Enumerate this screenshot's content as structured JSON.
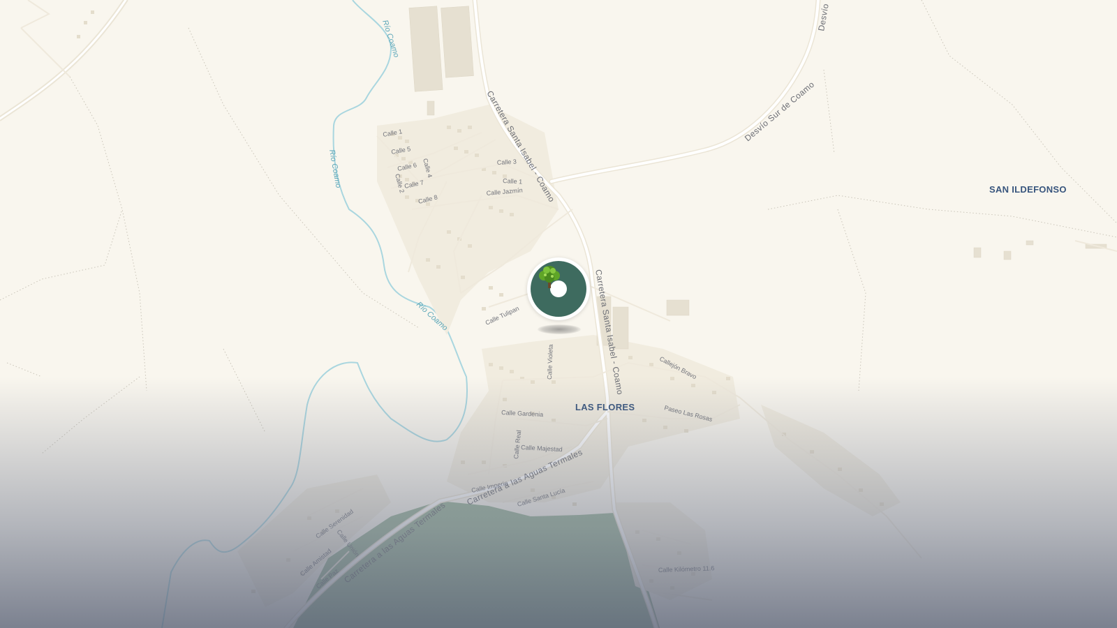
{
  "map": {
    "place_labels": {
      "las_flores": "LAS FLORES",
      "san_ildefonso": "SAN ILDEFONSO"
    },
    "roads": {
      "carretera_si_coamo_north": "Carretera Santa Isabel - Coamo",
      "carretera_si_coamo_south": "Carretera Santa Isabel - Coamo",
      "desvio_sur": "Desvío Sur de Coamo",
      "desvio_top": "Desvío",
      "aguas_termales_1": "Carretera a las Aguas Termales",
      "aguas_termales_2": "Carretera a las Aguas Termales"
    },
    "rivers": {
      "rio_1": "Río Coamo",
      "rio_2": "Río Coamo",
      "rio_3": "Río Coamo"
    },
    "streets": {
      "calle_1_a": "Calle 1",
      "calle_5": "Calle 5",
      "calle_6": "Calle 6",
      "calle_4": "Calle 4",
      "calle_7": "Calle 7",
      "calle_2": "Calle 2",
      "calle_8": "Calle 8",
      "calle_3": "Calle 3",
      "calle_1_b": "Calle 1",
      "calle_jazmin": "Calle Jazmín",
      "calle_tulipan": "Calle Tulipan",
      "calle_violeta": "Calle Violeta",
      "callejon_bravo": "Callejón Bravo",
      "paseo_las_rosas": "Paseo Las Rosas",
      "calle_gardenia": "Calle Gardenia",
      "calle_real": "Calle Real",
      "calle_majestad": "Calle Majestad",
      "calle_imperio": "Calle Imperio",
      "calle_santa_lucia": "Calle Santa Lucía",
      "calle_serenidad": "Calle Serenidad",
      "calle_union": "Calle Unión",
      "calle_amistad": "Calle Amistad",
      "calle_paz": "Calle Paz",
      "calle_km": "Calle Kilómetro 11.6"
    },
    "colors": {
      "land": "#f9f6ee",
      "road": "#ffffff",
      "road_casing": "#ebe5d6",
      "river": "#a9d6df",
      "park": "#9ab59a",
      "marker_fill": "#3e6b5f",
      "place_label": "#38557d"
    },
    "marker": {
      "icon": "tree-icon"
    }
  }
}
